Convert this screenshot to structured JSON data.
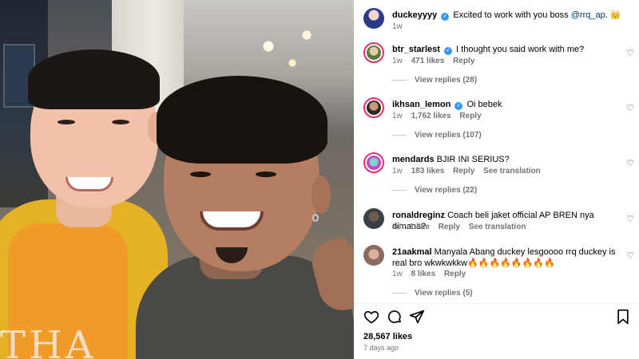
{
  "post": {
    "shirt_text": "THA"
  },
  "caption": {
    "username": "duckeyyyy",
    "text": "Excited to work with you boss ",
    "mention": "@rrq_ap",
    "suffix": ". 👑",
    "time": "1w"
  },
  "comments": [
    {
      "username": "btr_starlest",
      "verified": true,
      "text": "I thought you said work with me?",
      "time": "1w",
      "likes": "471 likes",
      "reply": "Reply",
      "view_replies": "View replies (28)"
    },
    {
      "username": "ikhsan_lemon",
      "verified": true,
      "text": "Oi bebek",
      "time": "1w",
      "likes": "1,762 likes",
      "reply": "Reply",
      "view_replies": "View replies (107)"
    },
    {
      "username": "mendards",
      "verified": false,
      "text": "BJIR INI SERIUS?",
      "time": "1w",
      "likes": "183 likes",
      "reply": "Reply",
      "translate": "See translation",
      "view_replies": "View replies (22)"
    },
    {
      "username": "ronaldreginz",
      "verified": false,
      "text": "Coach beli jaket official AP BREN nya dimana?",
      "time": "1d",
      "likes": "1 like",
      "reply": "Reply",
      "translate": "See translation"
    },
    {
      "username": "21aakmal",
      "verified": false,
      "text": "Manyala Abang duckey lesgoooo rrq duckey is real bro wkwkwkkw🔥🔥🔥🔥🔥🔥🔥🔥",
      "time": "1w",
      "likes": "8 likes",
      "reply": "Reply",
      "view_replies": "View replies (5)"
    }
  ],
  "footer": {
    "likes": "28,567 likes",
    "posted": "7 days ago"
  },
  "icons": {
    "verified": "verified-badge-icon",
    "like": "heart-icon",
    "comment": "comment-bubble-icon",
    "share": "paper-plane-icon",
    "save": "bookmark-icon"
  },
  "colors": {
    "verified": "#3897f0",
    "story_ring": "#e1306c",
    "muted_text": "#737373",
    "mention": "#00376b"
  }
}
